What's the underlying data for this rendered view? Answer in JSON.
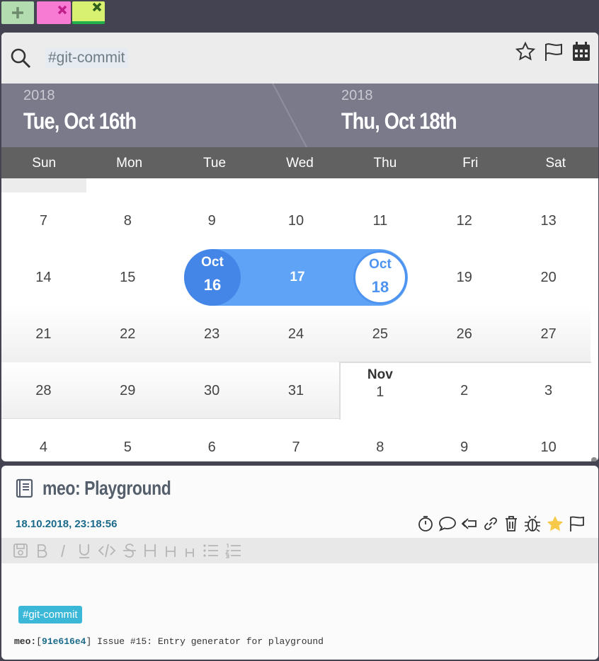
{
  "tabs": [
    {
      "name": "add",
      "icon": "plus-icon",
      "color": "#b3dcb1"
    },
    {
      "name": "pink",
      "icon": "close-icon",
      "color": "#f77ad3"
    },
    {
      "name": "lime",
      "icon": "close-icon",
      "color": "#d8f170"
    }
  ],
  "search": {
    "value": "#git-commit",
    "icon": "search-icon"
  },
  "search_actions": [
    "star-icon",
    "flag-icon",
    "calendar-icon"
  ],
  "range": {
    "start": {
      "year": "2018",
      "date": "Tue, Oct 16th"
    },
    "end": {
      "year": "2018",
      "date": "Thu, Oct 18th"
    }
  },
  "weekdays": [
    "Sun",
    "Mon",
    "Tue",
    "Wed",
    "Thu",
    "Fri",
    "Sat"
  ],
  "weeks": [
    [
      "7",
      "8",
      "9",
      "10",
      "11",
      "12",
      "13"
    ],
    [
      "14",
      "15",
      "16",
      "17",
      "18",
      "19",
      "20"
    ],
    [
      "21",
      "22",
      "23",
      "24",
      "25",
      "26",
      "27"
    ],
    [
      "28",
      "29",
      "30",
      "31",
      "1",
      "2",
      "3"
    ],
    [
      "4",
      "5",
      "6",
      "7",
      "8",
      "9",
      "10"
    ]
  ],
  "month_marker": "Nov",
  "selection": {
    "start_month": "Oct",
    "start_day": "16",
    "mid_day": "17",
    "end_month": "Oct",
    "end_day": "18"
  },
  "colors": {
    "selection": "#5ea3f5",
    "selection_start": "#4485e8",
    "header": "#7a7a8a",
    "weekday_row": "#616161",
    "accent_date": "#1b6a8c",
    "tag": "#3bb8d8"
  },
  "entry": {
    "title": "meo: Playground",
    "icon": "book-icon",
    "datetime": "18.10.2018, 23:18:56",
    "actions": [
      "timer-icon",
      "comment-icon",
      "reply-icon",
      "link-icon",
      "trash-icon",
      "bug-icon",
      "star-filled-icon",
      "flag-icon"
    ],
    "toolbar": [
      "save-icon",
      "bold-icon",
      "italic-icon",
      "underline-icon",
      "code-icon",
      "strike-icon",
      "h1-icon",
      "h2-icon",
      "h3-icon",
      "bullet-list-icon",
      "numbered-list-icon"
    ],
    "tag": "#git-commit",
    "commit": {
      "project": "meo:",
      "open": "[",
      "hash": "91e616e4",
      "close": "]",
      "message": "Issue #15: Entry generator for playground"
    }
  }
}
